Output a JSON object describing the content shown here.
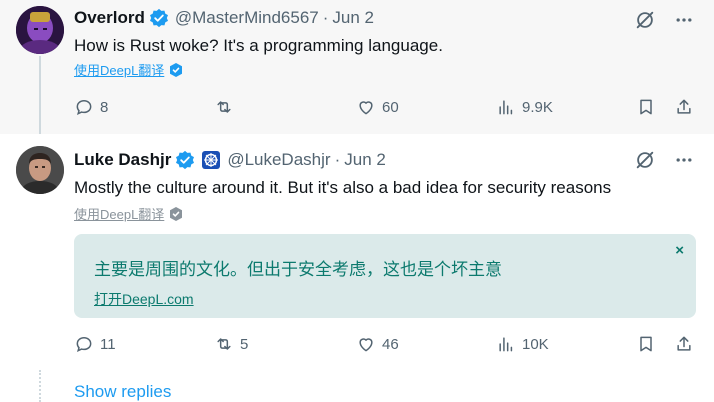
{
  "tweets": [
    {
      "name": "Overlord",
      "handle": "@MasterMind6567",
      "separator": "·",
      "date": "Jun 2",
      "text": "How is Rust woke? It's a programming language.",
      "translate_label": "使用DeepL翻译",
      "replies": "8",
      "reposts": "",
      "likes": "60",
      "views": "9.9K"
    },
    {
      "name": "Luke Dashjr",
      "handle": "@LukeDashjr",
      "separator": "·",
      "date": "Jun 2",
      "text": "Mostly the culture around it. But it's also a bad idea for security reasons",
      "translate_label": "使用DeepL翻译",
      "translation": {
        "text": "主要是周围的文化。但出于安全考虑，这也是个坏主意",
        "open_link": "打开DeepL.com",
        "close": "×"
      },
      "replies": "11",
      "reposts": "5",
      "likes": "46",
      "views": "10K"
    }
  ],
  "show_replies": "Show replies",
  "colors": {
    "accent": "#1d9bf0",
    "muted": "#536471",
    "translation_bg": "#dbeaea",
    "translation_text": "#0c7a6e",
    "tweet1_bg": "#f7f7f7"
  },
  "icons": [
    "verified-badge-icon",
    "grok-icon",
    "more-icon",
    "reply-icon",
    "repost-icon",
    "like-icon",
    "views-icon",
    "bookmark-icon",
    "share-icon",
    "deepl-icon",
    "org-badge-icon"
  ]
}
